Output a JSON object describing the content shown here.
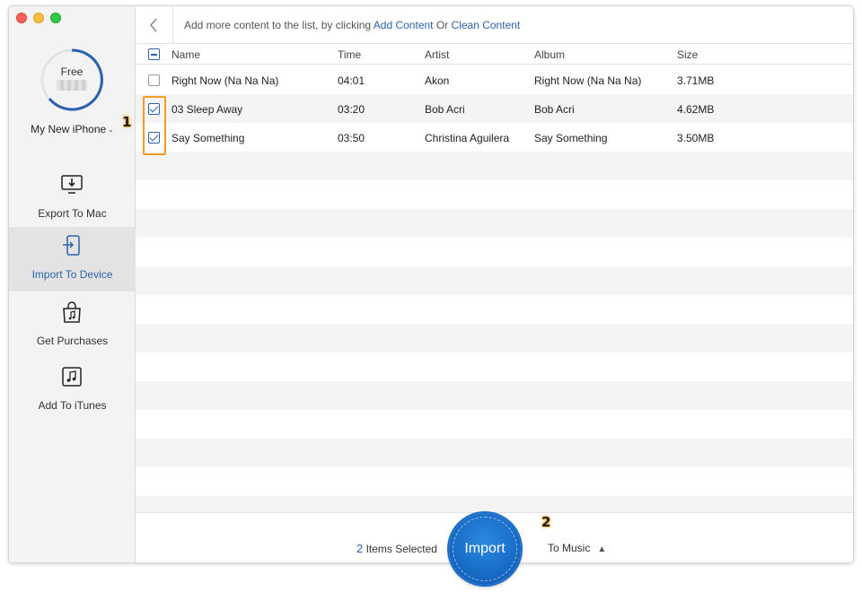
{
  "sidebar": {
    "storage_label": "Free",
    "device_name": "My New iPhone",
    "nav": [
      {
        "label": "Export To Mac",
        "icon": "export-to-mac-icon"
      },
      {
        "label": "Import To Device",
        "icon": "import-to-device-icon",
        "active": true
      },
      {
        "label": "Get Purchases",
        "icon": "shopping-bag-music-icon"
      },
      {
        "label": "Add To iTunes",
        "icon": "itunes-note-icon"
      }
    ]
  },
  "toolbar": {
    "hint_prefix": "Add more content to the list, by clicking",
    "add_content": "Add Content",
    "or_text": "Or",
    "clean_content": "Clean Content"
  },
  "table": {
    "columns": [
      "Name",
      "Time",
      "Artist",
      "Album",
      "Size"
    ],
    "rows": [
      {
        "name": "Right Now (Na Na Na)",
        "time": "04:01",
        "artist": "Akon",
        "album": "Right Now (Na Na Na)",
        "size": "3.71MB",
        "checked": false
      },
      {
        "name": "03 Sleep Away",
        "time": "03:20",
        "artist": "Bob Acri",
        "album": "Bob Acri",
        "size": "4.62MB",
        "checked": true
      },
      {
        "name": "Say Something",
        "time": "03:50",
        "artist": "Christina Aguilera",
        "album": "Say Something",
        "size": "3.50MB",
        "checked": true
      }
    ]
  },
  "footer": {
    "selected_count": "2",
    "selected_label": "Items Selected",
    "import_label": "Import",
    "destination": "To Music"
  },
  "callouts": {
    "one": "1",
    "two": "2"
  },
  "colors": {
    "accent": "#2c62ad",
    "highlight": "#f59a23",
    "import_button": "#1565c0"
  }
}
